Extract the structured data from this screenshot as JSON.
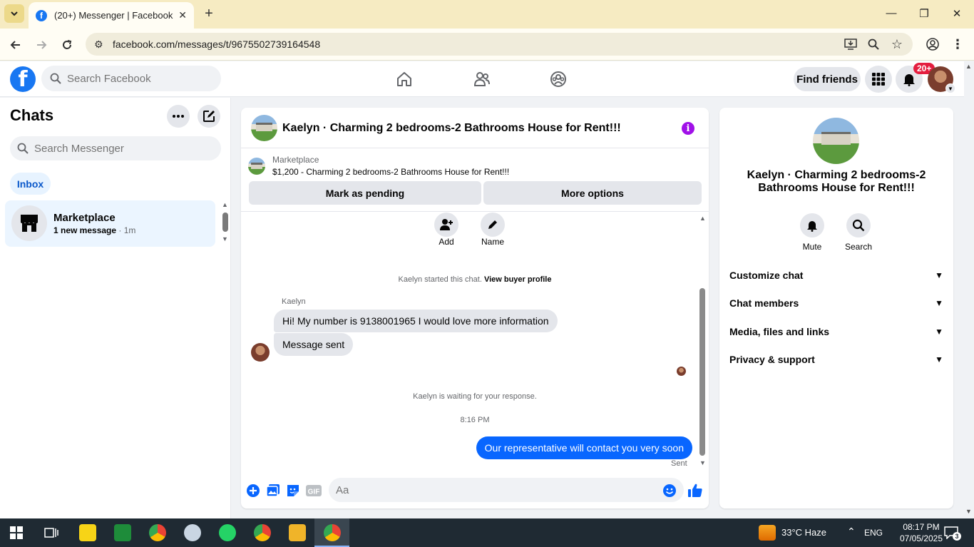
{
  "browser": {
    "tab_title": "(20+) Messenger | Facebook",
    "url": "facebook.com/messages/t/9675502739164548"
  },
  "header": {
    "search_placeholder": "Search Facebook",
    "find_friends": "Find friends",
    "notif_count": "20+"
  },
  "left": {
    "title": "Chats",
    "search_placeholder": "Search Messenger",
    "inbox": "Inbox",
    "chats": [
      {
        "name": "Marketplace",
        "sub": "1 new message",
        "time": " · 1m"
      }
    ]
  },
  "conversation": {
    "title": "Kaelyn · Charming 2 bedrooms-2 Bathrooms House for Rent!!!",
    "marketplace_label": "Marketplace",
    "listing": "$1,200 - Charming 2 bedrooms-2 Bathrooms House for Rent!!!",
    "mark_pending": "Mark as pending",
    "more_options": "More options",
    "add_label": "Add",
    "name_label": "Name",
    "started_text": "Kaelyn started this chat. ",
    "view_profile": "View buyer profile",
    "sender": "Kaelyn",
    "msg1": "Hi! My number is 9138001965 I would love more information",
    "msg2": "Message sent",
    "waiting": "Kaelyn is waiting for your response.",
    "time": "8:16 PM",
    "out_msg": "Our representative will contact you very soon",
    "sent": "Sent",
    "composer_placeholder": "Aa"
  },
  "right": {
    "title": "Kaelyn · Charming 2 bedrooms-2 Bathrooms House for Rent!!!",
    "mute": "Mute",
    "search": "Search",
    "rows": [
      "Customize chat",
      "Chat members",
      "Media, files and links",
      "Privacy & support"
    ]
  },
  "taskbar": {
    "weather": "33°C  Haze",
    "lang": "ENG",
    "time": "08:17 PM",
    "date": "07/05/2025",
    "notif": "3"
  },
  "colors": {
    "fb_blue": "#1877f2",
    "messenger_blue": "#0866ff",
    "info_purple": "#a010e8",
    "badge_red": "#e41e3f"
  }
}
